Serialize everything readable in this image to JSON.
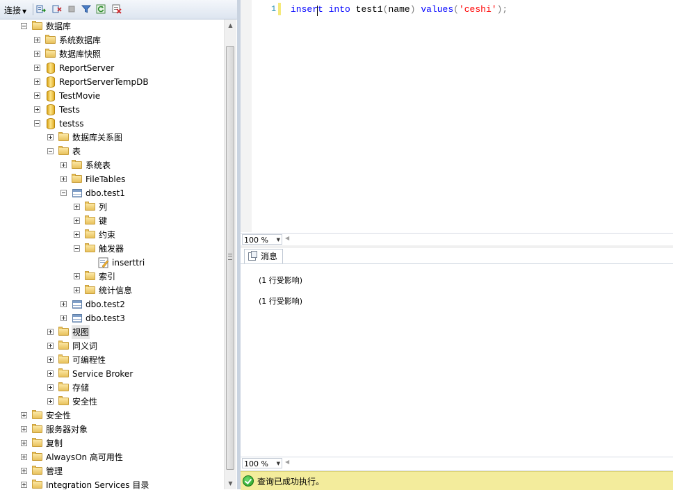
{
  "toolbar": {
    "connect_label": "连接",
    "icons": [
      "connect-object-explorer-icon",
      "disconnect-icon",
      "stop-icon",
      "filter-icon",
      "refresh-icon",
      "collapse-icon"
    ]
  },
  "tree": [
    {
      "label": "数据库",
      "level": 1,
      "state": "expanded",
      "icon": "folder"
    },
    {
      "label": "系统数据库",
      "level": 2,
      "state": "collapsed",
      "icon": "folder"
    },
    {
      "label": "数据库快照",
      "level": 2,
      "state": "collapsed",
      "icon": "folder"
    },
    {
      "label": "ReportServer",
      "level": 2,
      "state": "collapsed",
      "icon": "database"
    },
    {
      "label": "ReportServerTempDB",
      "level": 2,
      "state": "collapsed",
      "icon": "database"
    },
    {
      "label": "TestMovie",
      "level": 2,
      "state": "collapsed",
      "icon": "database"
    },
    {
      "label": "Tests",
      "level": 2,
      "state": "collapsed",
      "icon": "database"
    },
    {
      "label": "testss",
      "level": 2,
      "state": "expanded",
      "icon": "database"
    },
    {
      "label": "数据库关系图",
      "level": 3,
      "state": "collapsed",
      "icon": "folder"
    },
    {
      "label": "表",
      "level": 3,
      "state": "expanded",
      "icon": "folder"
    },
    {
      "label": "系统表",
      "level": 4,
      "state": "collapsed",
      "icon": "folder"
    },
    {
      "label": "FileTables",
      "level": 4,
      "state": "collapsed",
      "icon": "folder"
    },
    {
      "label": "dbo.test1",
      "level": 4,
      "state": "expanded",
      "icon": "table"
    },
    {
      "label": "列",
      "level": 5,
      "state": "collapsed",
      "icon": "folder"
    },
    {
      "label": "键",
      "level": 5,
      "state": "collapsed",
      "icon": "folder"
    },
    {
      "label": "约束",
      "level": 5,
      "state": "collapsed",
      "icon": "folder"
    },
    {
      "label": "触发器",
      "level": 5,
      "state": "expanded",
      "icon": "folder"
    },
    {
      "label": "inserttri",
      "level": 6,
      "state": "leaf",
      "icon": "trigger"
    },
    {
      "label": "索引",
      "level": 5,
      "state": "collapsed",
      "icon": "folder"
    },
    {
      "label": "统计信息",
      "level": 5,
      "state": "collapsed",
      "icon": "folder"
    },
    {
      "label": "dbo.test2",
      "level": 4,
      "state": "collapsed",
      "icon": "table"
    },
    {
      "label": "dbo.test3",
      "level": 4,
      "state": "collapsed",
      "icon": "table"
    },
    {
      "label": "视图",
      "level": 3,
      "state": "collapsed",
      "icon": "folder",
      "selected": true
    },
    {
      "label": "同义词",
      "level": 3,
      "state": "collapsed",
      "icon": "folder"
    },
    {
      "label": "可编程性",
      "level": 3,
      "state": "collapsed",
      "icon": "folder"
    },
    {
      "label": "Service Broker",
      "level": 3,
      "state": "collapsed",
      "icon": "folder"
    },
    {
      "label": "存储",
      "level": 3,
      "state": "collapsed",
      "icon": "folder"
    },
    {
      "label": "安全性",
      "level": 3,
      "state": "collapsed",
      "icon": "folder"
    },
    {
      "label": "安全性",
      "level": 1,
      "state": "collapsed",
      "icon": "folder"
    },
    {
      "label": "服务器对象",
      "level": 1,
      "state": "collapsed",
      "icon": "folder"
    },
    {
      "label": "复制",
      "level": 1,
      "state": "collapsed",
      "icon": "folder"
    },
    {
      "label": "AlwaysOn 高可用性",
      "level": 1,
      "state": "collapsed",
      "icon": "folder"
    },
    {
      "label": "管理",
      "level": 1,
      "state": "collapsed",
      "icon": "folder"
    },
    {
      "label": "Integration Services 目录",
      "level": 1,
      "state": "collapsed",
      "icon": "folder"
    }
  ],
  "editor": {
    "line_number": "1",
    "code": {
      "kw1": "insert",
      "kw2": "into",
      "obj": "test1",
      "lparen": "(",
      "col": "name",
      "rparen": ")",
      "kw3": "values",
      "paren_open": "(",
      "str": "'ceshi'",
      "paren_close": ")",
      "semi": ";"
    },
    "zoom": "100 %"
  },
  "results": {
    "tab_label": "消息",
    "messages": [
      "(1  行受影响)",
      "(1  行受影响)"
    ],
    "zoom": "100 %"
  },
  "status": {
    "text": "查询已成功执行。",
    "color": "#f3ec9c"
  }
}
